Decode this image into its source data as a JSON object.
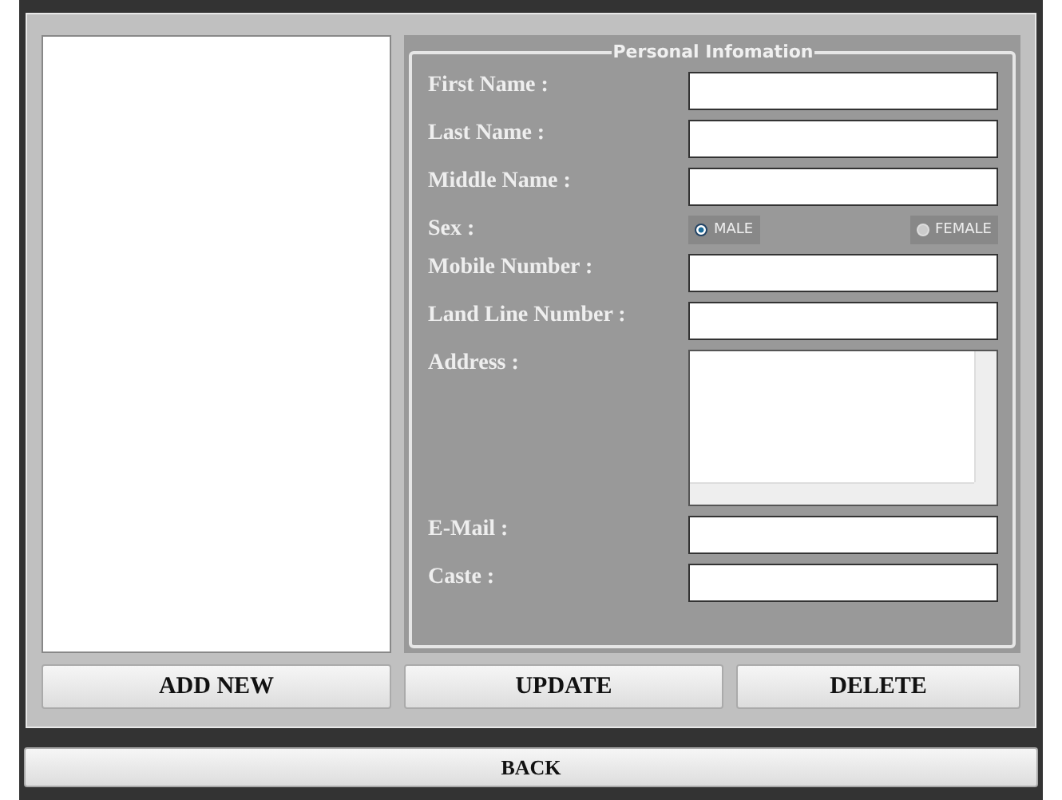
{
  "group": {
    "title": "Personal Infomation"
  },
  "fields": [
    {
      "label": "First Name :",
      "kind": "text"
    },
    {
      "label": "Last Name :",
      "kind": "text"
    },
    {
      "label": "Middle Name :",
      "kind": "text"
    },
    {
      "label": "Sex :",
      "kind": "radio",
      "options": [
        {
          "label": "MALE",
          "selected": true
        },
        {
          "label": "FEMALE",
          "selected": false
        }
      ]
    },
    {
      "label": "Mobile Number :",
      "kind": "text"
    },
    {
      "label": "Land Line Number :",
      "kind": "text"
    },
    {
      "label": "Address :",
      "kind": "textarea"
    },
    {
      "label": "E-Mail :",
      "kind": "text"
    },
    {
      "label": "Caste :",
      "kind": "text"
    }
  ],
  "buttons": [
    "ADD NEW",
    "UPDATE",
    "DELETE"
  ],
  "back_button": "BACK"
}
